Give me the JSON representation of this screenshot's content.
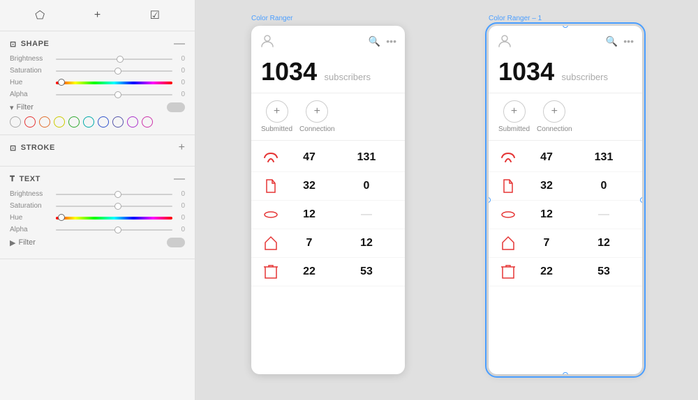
{
  "toolbar": {
    "icon1": "⬠",
    "icon2": "+",
    "icon3": "☑"
  },
  "shape_section": {
    "title": "SHAPE",
    "brightness_label": "Brightness",
    "brightness_value": "0",
    "brightness_thumb_pos": "52%",
    "saturation_label": "Saturation",
    "saturation_value": "0",
    "saturation_thumb_pos": "50%",
    "hue_label": "Hue",
    "hue_value": "0",
    "hue_thumb_pos": "2%",
    "alpha_label": "Alpha",
    "alpha_value": "0",
    "alpha_thumb_pos": "50%",
    "filter_label": "Filter",
    "colors": [
      {
        "color": "transparent",
        "border": "#aaa"
      },
      {
        "color": "transparent",
        "border": "#e53"
      },
      {
        "color": "transparent",
        "border": "#e63"
      },
      {
        "color": "transparent",
        "border": "#cc0"
      },
      {
        "color": "transparent",
        "border": "#3a3"
      },
      {
        "color": "transparent",
        "border": "#0aa"
      },
      {
        "color": "transparent",
        "border": "#33c"
      },
      {
        "color": "transparent",
        "border": "#55a"
      },
      {
        "color": "transparent",
        "border": "#a3c"
      },
      {
        "color": "transparent",
        "border": "#c3a"
      }
    ]
  },
  "stroke_section": {
    "title": "STROKE"
  },
  "text_section": {
    "title": "TEXT",
    "brightness_label": "Brightness",
    "brightness_value": "0",
    "brightness_thumb_pos": "50%",
    "saturation_label": "Saturation",
    "saturation_value": "0",
    "saturation_thumb_pos": "50%",
    "hue_label": "Hue",
    "hue_value": "0",
    "hue_thumb_pos": "2%",
    "alpha_label": "Alpha",
    "alpha_value": "0",
    "alpha_thumb_pos": "50%",
    "filter_label": "Filter"
  },
  "frame1": {
    "label": "Color Ranger",
    "subscribers_count": "1034",
    "subscribers_text": "subscribers",
    "btn1_label": "Submitted",
    "btn2_label": "Connection",
    "rows": [
      {
        "num1": "47",
        "num2": "131"
      },
      {
        "num1": "32",
        "num2": "0"
      },
      {
        "num1": "12",
        "num2": "—"
      },
      {
        "num1": "7",
        "num2": "12"
      },
      {
        "num1": "22",
        "num2": "53"
      }
    ]
  },
  "frame2": {
    "label": "Color Ranger – 1",
    "subscribers_count": "1034",
    "subscribers_text": "subscribers",
    "btn1_label": "Submitted",
    "btn2_label": "Connection",
    "rows": [
      {
        "num1": "47",
        "num2": "131"
      },
      {
        "num1": "32",
        "num2": "0"
      },
      {
        "num1": "12",
        "num2": "—"
      },
      {
        "num1": "7",
        "num2": "12"
      },
      {
        "num1": "22",
        "num2": "53"
      }
    ]
  }
}
